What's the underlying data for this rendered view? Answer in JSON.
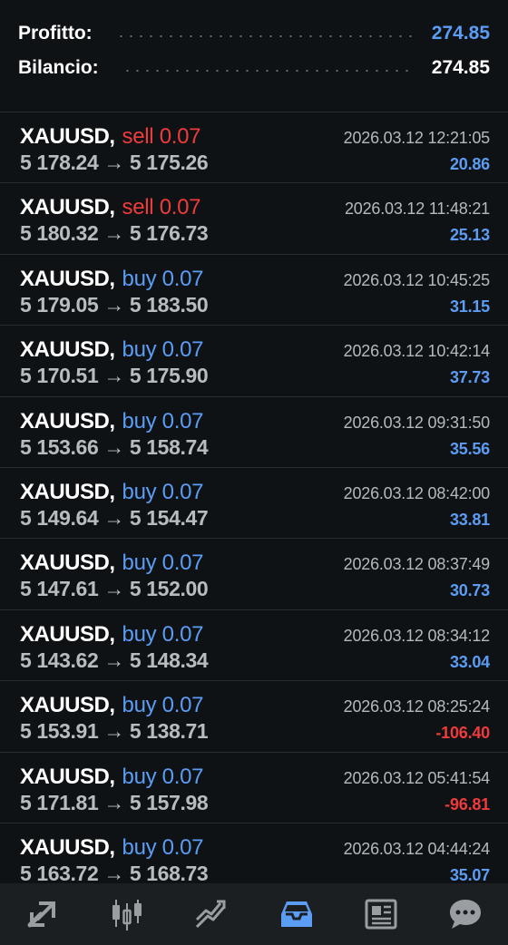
{
  "summary": {
    "profit_label": "Profitto:",
    "profit_value": "274.85",
    "balance_label": "Bilancio:",
    "balance_value": "274.85",
    "profit_color": "#5b9cf5"
  },
  "trades": [
    {
      "symbol": "XAUUSD,",
      "side": "sell",
      "volume": "sell 0.07",
      "prices": "5 178.24 → 5 175.26",
      "time": "2026.03.12 12:21:05",
      "profit": "20.86",
      "profit_sign": "pos"
    },
    {
      "symbol": "XAUUSD,",
      "side": "sell",
      "volume": "sell 0.07",
      "prices": "5 180.32 → 5 176.73",
      "time": "2026.03.12 11:48:21",
      "profit": "25.13",
      "profit_sign": "pos"
    },
    {
      "symbol": "XAUUSD,",
      "side": "buy",
      "volume": "buy 0.07",
      "prices": "5 179.05 → 5 183.50",
      "time": "2026.03.12 10:45:25",
      "profit": "31.15",
      "profit_sign": "pos"
    },
    {
      "symbol": "XAUUSD,",
      "side": "buy",
      "volume": "buy 0.07",
      "prices": "5 170.51 → 5 175.90",
      "time": "2026.03.12 10:42:14",
      "profit": "37.73",
      "profit_sign": "pos"
    },
    {
      "symbol": "XAUUSD,",
      "side": "buy",
      "volume": "buy 0.07",
      "prices": "5 153.66 → 5 158.74",
      "time": "2026.03.12 09:31:50",
      "profit": "35.56",
      "profit_sign": "pos"
    },
    {
      "symbol": "XAUUSD,",
      "side": "buy",
      "volume": "buy 0.07",
      "prices": "5 149.64 → 5 154.47",
      "time": "2026.03.12 08:42:00",
      "profit": "33.81",
      "profit_sign": "pos"
    },
    {
      "symbol": "XAUUSD,",
      "side": "buy",
      "volume": "buy 0.07",
      "prices": "5 147.61 → 5 152.00",
      "time": "2026.03.12 08:37:49",
      "profit": "30.73",
      "profit_sign": "pos"
    },
    {
      "symbol": "XAUUSD,",
      "side": "buy",
      "volume": "buy 0.07",
      "prices": "5 143.62 → 5 148.34",
      "time": "2026.03.12 08:34:12",
      "profit": "33.04",
      "profit_sign": "pos"
    },
    {
      "symbol": "XAUUSD,",
      "side": "buy",
      "volume": "buy 0.07",
      "prices": "5 153.91 → 5 138.71",
      "time": "2026.03.12 08:25:24",
      "profit": "-106.40",
      "profit_sign": "neg"
    },
    {
      "symbol": "XAUUSD,",
      "side": "buy",
      "volume": "buy 0.07",
      "prices": "5 171.81 → 5 157.98",
      "time": "2026.03.12 05:41:54",
      "profit": "-96.81",
      "profit_sign": "neg"
    },
    {
      "symbol": "XAUUSD,",
      "side": "buy",
      "volume": "buy 0.07",
      "prices": "5 163.72 → 5 168.73",
      "time": "2026.03.12 04:44:24",
      "profit": "35.07",
      "profit_sign": "pos"
    }
  ],
  "navbar": {
    "items": [
      {
        "icon": "quotes-icon",
        "active": false
      },
      {
        "icon": "chart-icon",
        "active": false
      },
      {
        "icon": "trade-icon",
        "active": false
      },
      {
        "icon": "history-icon",
        "active": true
      },
      {
        "icon": "news-icon",
        "active": false
      },
      {
        "icon": "messages-icon",
        "active": false
      }
    ],
    "active_color": "#5b9cf5",
    "inactive_color": "#9a9ea2"
  }
}
